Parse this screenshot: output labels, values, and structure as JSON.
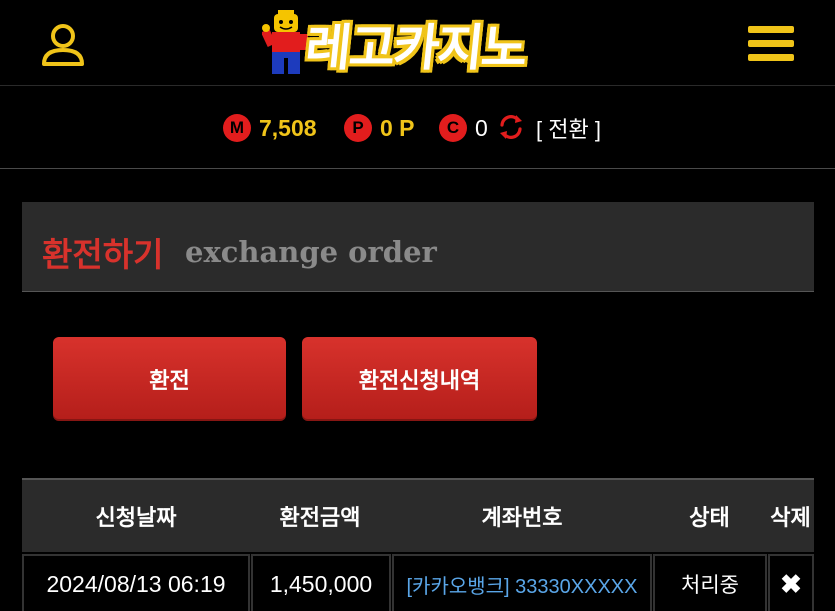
{
  "header": {
    "logo_text": "레고카지노",
    "user_icon": "user-icon",
    "menu_icon": "hamburger-menu-icon"
  },
  "balance": {
    "money_badge": "M",
    "money_value": "7,508",
    "point_badge": "P",
    "point_value": "0 P",
    "coupon_badge": "C",
    "coupon_value": "0",
    "refresh_icon": "refresh-icon",
    "convert_label": "[ 전환 ]"
  },
  "title": {
    "korean": "환전하기",
    "english": "exchange order"
  },
  "buttons": {
    "exchange": "환전",
    "history": "환전신청내역"
  },
  "table": {
    "headers": [
      "신청날짜",
      "환전금액",
      "계좌번호",
      "상태",
      "삭제"
    ],
    "rows": [
      {
        "date": "2024/08/13 06:19",
        "amount": "1,450,000",
        "account": "[카카오뱅크] 33330XXXXX",
        "status": "처리중",
        "delete": "✖"
      }
    ]
  },
  "colors": {
    "accent_red": "#d8322c",
    "logo_yellow": "#f0c419",
    "link_blue": "#5aa6e8",
    "panel_gray": "#2b2b2b"
  }
}
